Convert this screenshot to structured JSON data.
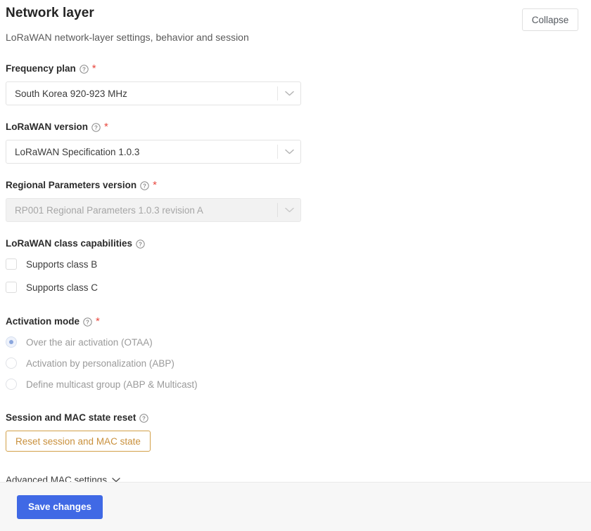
{
  "header": {
    "title": "Network layer",
    "subtitle": "LoRaWAN network-layer settings, behavior and session",
    "collapse_label": "Collapse"
  },
  "icons": {
    "help": "question-mark-circle-icon",
    "chevron_down": "chevron-down-icon"
  },
  "colors": {
    "primary": "#4069e5",
    "warning": "#c9903c",
    "required": "#e8483f",
    "footer_bg": "#f7f7f7"
  },
  "fields": {
    "frequency_plan": {
      "label": "Frequency plan",
      "required": true,
      "value": "South Korea 920-923 MHz",
      "disabled": false
    },
    "lorawan_version": {
      "label": "LoRaWAN version",
      "required": true,
      "value": "LoRaWAN Specification 1.0.3",
      "disabled": false
    },
    "regional_parameters_version": {
      "label": "Regional Parameters version",
      "required": true,
      "value": "RP001 Regional Parameters 1.0.3 revision A",
      "disabled": true
    },
    "class_capabilities": {
      "label": "LoRaWAN class capabilities",
      "required": false,
      "options": [
        {
          "label": "Supports class B",
          "checked": false
        },
        {
          "label": "Supports class C",
          "checked": false
        }
      ]
    },
    "activation_mode": {
      "label": "Activation mode",
      "required": true,
      "disabled": true,
      "options": [
        {
          "label": "Over the air activation (OTAA)",
          "selected": true
        },
        {
          "label": "Activation by personalization (ABP)",
          "selected": false
        },
        {
          "label": "Define multicast group (ABP & Multicast)",
          "selected": false
        }
      ]
    },
    "session_reset": {
      "label": "Session and MAC state reset",
      "required": false,
      "button_label": "Reset session and MAC state"
    }
  },
  "advanced": {
    "label": "Advanced MAC settings"
  },
  "footer": {
    "save_label": "Save changes"
  }
}
